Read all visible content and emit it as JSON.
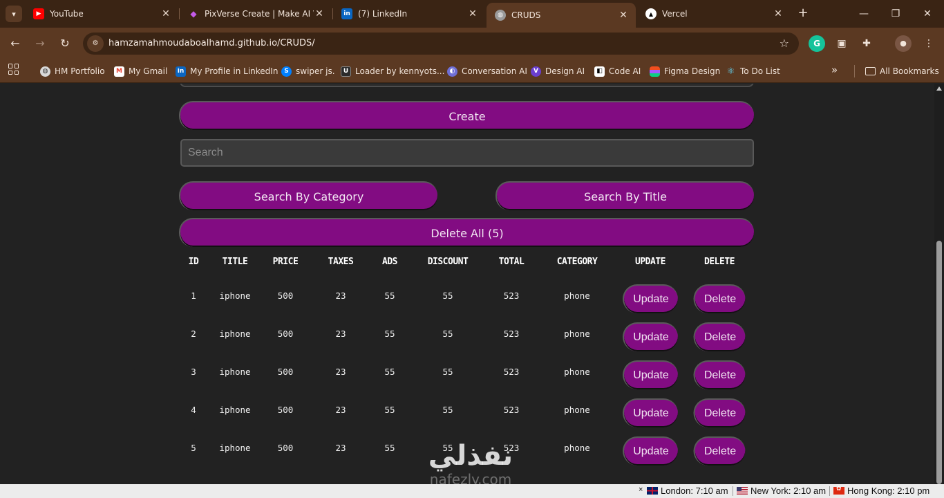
{
  "browser": {
    "tabs": [
      {
        "title": "YouTube",
        "icon": "youtube-icon",
        "color": "#ff0000",
        "active": false
      },
      {
        "title": "PixVerse Create | Make AI Vid",
        "icon": "pixverse-icon",
        "color": "#9b3bd6",
        "active": false
      },
      {
        "title": "(7) LinkedIn",
        "icon": "linkedin-icon",
        "color": "#0a66c2",
        "active": false
      },
      {
        "title": "CRUDS",
        "icon": "globe-icon",
        "color": "#8a8a8a",
        "active": true
      },
      {
        "title": "Vercel",
        "icon": "vercel-icon",
        "color": "#000000",
        "active": false
      }
    ],
    "url": "hamzamahmoudaboalhamd.github.io/CRUDS/",
    "bookmarks": [
      {
        "label": "HM Portfolio",
        "icon": "globe-icon"
      },
      {
        "label": "My Gmail",
        "icon": "gmail-icon"
      },
      {
        "label": "My Profile in LinkedIn",
        "icon": "linkedin-icon"
      },
      {
        "label": "swiper js.",
        "icon": "swiper-icon"
      },
      {
        "label": "Loader by kennyots...",
        "icon": "uiverse-icon"
      },
      {
        "label": "Conversation AI",
        "icon": "conversation-ai-icon"
      },
      {
        "label": "Design AI",
        "icon": "design-ai-icon"
      },
      {
        "label": "Code AI",
        "icon": "code-ai-icon"
      },
      {
        "label": "Figma Design",
        "icon": "figma-icon"
      },
      {
        "label": "To Do List",
        "icon": "react-icon"
      }
    ],
    "all_bookmarks_label": "All Bookmarks"
  },
  "app": {
    "create_label": "Create",
    "search_placeholder": "Search",
    "search_by_category_label": "Search By Category",
    "search_by_title_label": "Search By Title",
    "delete_all_label": "Delete All (5)",
    "accent_color": "#820c82",
    "table": {
      "headers": [
        "ID",
        "TITLE",
        "PRICE",
        "TAXES",
        "ADS",
        "DISCOUNT",
        "TOTAL",
        "CATEGORY",
        "UPDATE",
        "DELETE"
      ],
      "update_label": "Update",
      "delete_label": "Delete",
      "rows": [
        {
          "id": "1",
          "title": "iphone",
          "price": "500",
          "taxes": "23",
          "ads": "55",
          "discount": "55",
          "total": "523",
          "category": "phone"
        },
        {
          "id": "2",
          "title": "iphone",
          "price": "500",
          "taxes": "23",
          "ads": "55",
          "discount": "55",
          "total": "523",
          "category": "phone"
        },
        {
          "id": "3",
          "title": "iphone",
          "price": "500",
          "taxes": "23",
          "ads": "55",
          "discount": "55",
          "total": "523",
          "category": "phone"
        },
        {
          "id": "4",
          "title": "iphone",
          "price": "500",
          "taxes": "23",
          "ads": "55",
          "discount": "55",
          "total": "523",
          "category": "phone"
        },
        {
          "id": "5",
          "title": "iphone",
          "price": "500",
          "taxes": "23",
          "ads": "55",
          "discount": "55",
          "total": "523",
          "category": "phone"
        }
      ]
    }
  },
  "watermark": {
    "main": "نفذلي",
    "sub": "nafezly.com"
  },
  "clocks": {
    "close": "×",
    "london": "London: 7:10 am",
    "new_york": "New York: 2:10 am",
    "hong_kong": "Hong Kong: 2:10 pm"
  }
}
